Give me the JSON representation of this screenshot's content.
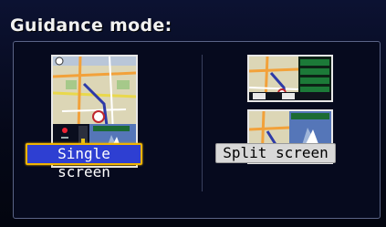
{
  "title": "Guidance mode:",
  "options": {
    "single_label": "Single screen",
    "split_label": "Split screen",
    "selected": "Single screen"
  },
  "colors": {
    "accent_selected": "#2e3fd2",
    "highlight_border": "#f0b400",
    "unselected_button": "#d8d8d8"
  },
  "icons": [
    "north-arrow-icon",
    "vehicle-position-icon",
    "destination-flag-icon",
    "turn-arrow-icon"
  ]
}
